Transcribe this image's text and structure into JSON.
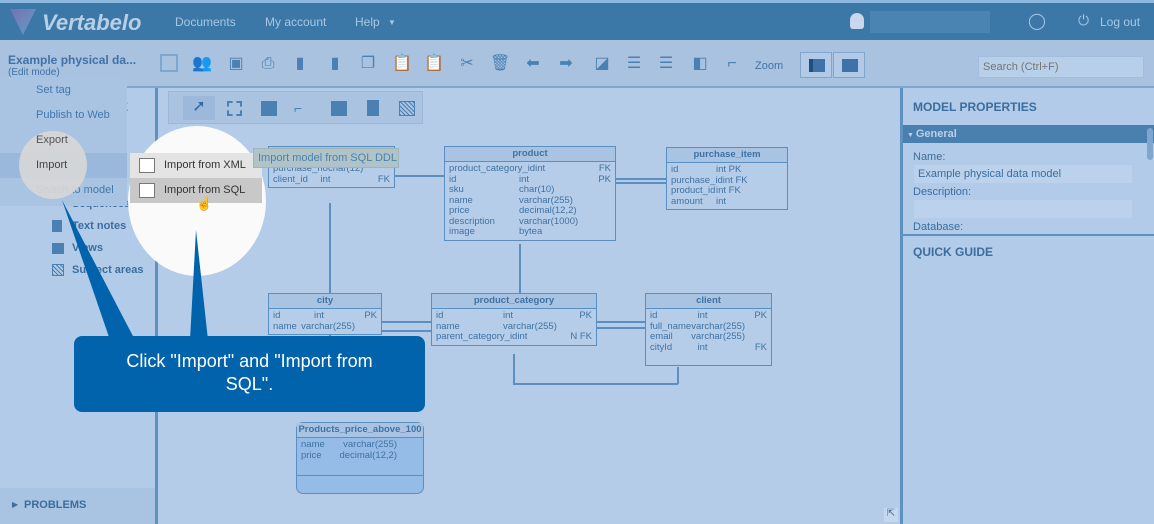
{
  "header": {
    "logo": "Vertabelo",
    "nav": [
      "Documents",
      "My account",
      "Help"
    ],
    "logout": "Log out"
  },
  "toolbar": {
    "model_name": "Example physical da...",
    "mode": "(Edit mode)",
    "zoom": "Zoom",
    "search_placeholder": "Search (Ctrl+F)"
  },
  "menu": {
    "items": [
      "Set tag",
      "Publish to Web",
      "Export",
      "Import",
      "Switch to model"
    ],
    "submenu": [
      "Import from XML",
      "Import from SQL"
    ],
    "tooltip": "Import model from SQL DDL"
  },
  "tree": {
    "items": [
      "Sequences",
      "Text notes",
      "Views",
      "Subject areas"
    ],
    "partial_header": "E"
  },
  "problems": "PROBLEMS",
  "right": {
    "title": "MODEL PROPERTIES",
    "section": "General",
    "name_label": "Name:",
    "name_value": "Example physical data model",
    "description_label": "Description:",
    "database_label": "Database:",
    "quick_guide": "QUICK GUIDE"
  },
  "callout": "Click \"Import\" and \"Import from SQL\".",
  "tables": [
    {
      "name": "",
      "rows": [
        [
          "purchase_no",
          "char(12)",
          ""
        ],
        [
          "client_id",
          "int",
          "FK"
        ]
      ]
    },
    {
      "name": "product",
      "rows": [
        [
          "product_category_id",
          "int",
          "FK"
        ],
        [
          "id",
          "int",
          "PK"
        ],
        [
          "sku",
          "char(10)",
          ""
        ],
        [
          "name",
          "varchar(255)",
          ""
        ],
        [
          "price",
          "decimal(12,2)",
          ""
        ],
        [
          "description",
          "varchar(1000)",
          ""
        ],
        [
          "image",
          "bytea",
          ""
        ]
      ]
    },
    {
      "name": "purchase_item",
      "rows": [
        [
          "id",
          "int PK",
          ""
        ],
        [
          "purchase_id",
          "int FK",
          ""
        ],
        [
          "product_id",
          "int FK",
          ""
        ],
        [
          "amount",
          "int",
          ""
        ]
      ]
    },
    {
      "name": "city",
      "rows": [
        [
          "id",
          "int",
          "PK"
        ],
        [
          "name",
          "varchar(255)",
          ""
        ]
      ]
    },
    {
      "name": "product_category",
      "rows": [
        [
          "id",
          "int",
          "PK"
        ],
        [
          "name",
          "varchar(255)",
          ""
        ],
        [
          "parent_category_id",
          "int",
          "N FK"
        ]
      ]
    },
    {
      "name": "client",
      "rows": [
        [
          "id",
          "int",
          "PK"
        ],
        [
          "full_name",
          "varchar(255)",
          ""
        ],
        [
          "email",
          "varchar(255)",
          ""
        ],
        [
          "cityId",
          "int",
          "FK"
        ]
      ]
    },
    {
      "name": "Products_price_above_100",
      "rows": [
        [
          "name",
          "varchar(255)",
          ""
        ],
        [
          "price",
          "decimal(12,2)",
          ""
        ]
      ]
    }
  ],
  "colors": {
    "header": "#3b78a8",
    "callout": "#0063ab",
    "canvas": "#b4cce8"
  }
}
